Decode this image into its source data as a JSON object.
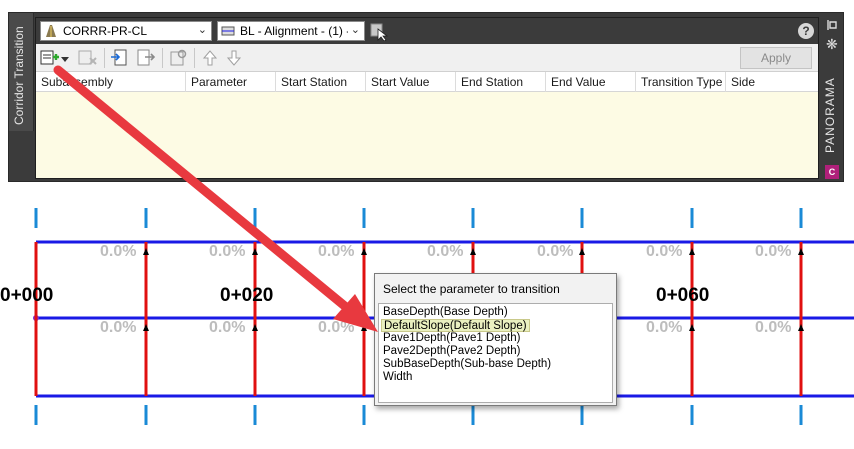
{
  "palette": {
    "vertical_tab_label": "Corridor Transition",
    "side_label": "PANORAMA",
    "c3d_logo": "C",
    "help": "?"
  },
  "toolbar": {
    "corridor_combo": "CORRR-PR-CL",
    "baseline_combo": "BL - Alignment - (1) - (",
    "apply_label": "Apply",
    "icons": [
      "add-transition-icon",
      "dropdown-arrow-icon",
      "delete-transition-icon",
      "import-icon",
      "export-icon",
      "settings-icon",
      "move-up-icon",
      "move-down-icon",
      "pick-from-drawing-icon"
    ]
  },
  "grid": {
    "columns": [
      "Subassembly",
      "Parameter",
      "Start Station",
      "Start Value",
      "End Station",
      "End Value",
      "Transition Type",
      "Side"
    ],
    "rows": []
  },
  "drawing": {
    "stations": [
      "0+000",
      "0+020",
      "0+060"
    ],
    "slope_label": "0.0%",
    "colors": {
      "alignment": "#1a1ae6",
      "ticks": "#e01010",
      "station_marks": "#1a8ad6",
      "arrow": "#e8393f"
    }
  },
  "popup": {
    "title": "Select the parameter to transition",
    "items": [
      "BaseDepth(Base Depth)",
      "DefaultSlope(Default Slope)",
      "Pave1Depth(Pave1 Depth)",
      "Pave2Depth(Pave2 Depth)",
      "SubBaseDepth(Sub-base Depth)",
      "Width"
    ],
    "selected_index": 1
  }
}
